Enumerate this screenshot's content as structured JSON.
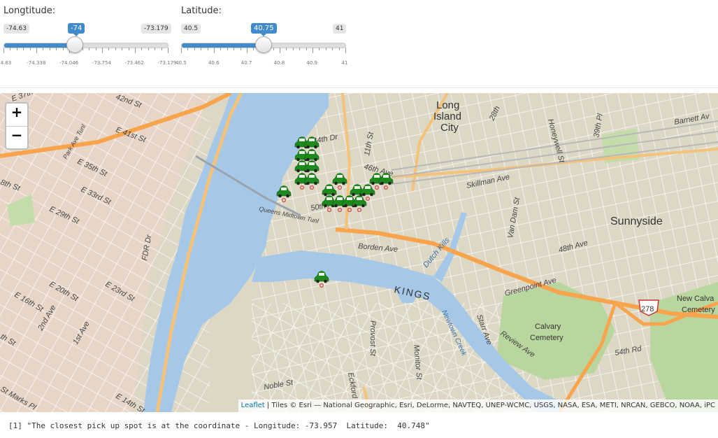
{
  "longitude_slider": {
    "title": "Longtitude:",
    "min_label": "-74.63",
    "max_label": "-73.179",
    "value_label": "-74",
    "value_fraction": 0.434,
    "tick_labels": [
      "-74.63",
      "-74.338",
      "-74.046",
      "-73.754",
      "-73.462",
      "-73.179"
    ]
  },
  "latitude_slider": {
    "title": "Latitude:",
    "min_label": "40.5",
    "max_label": "41",
    "value_label": "40.75",
    "value_fraction": 0.5,
    "tick_labels": [
      "40.5",
      "40.6",
      "40.7",
      "40.8",
      "40.9",
      "41"
    ]
  },
  "map": {
    "zoom_in_label": "+",
    "zoom_out_label": "−",
    "labels": {
      "long_island_city_1": "Long",
      "long_island_city_2": "Island",
      "long_island_city_3": "City",
      "sunnyside": "Sunnyside",
      "calvary_1": "Calvary",
      "calvary_2": "Cemetery",
      "new_calvary_1": "New Calva",
      "new_calvary_2": "Cemetery",
      "kings": "KINGS",
      "route": "278",
      "fdr": "FDR Dr",
      "e37": "E 37th St",
      "e42": "42nd St",
      "e41": "E 41st St",
      "e35": "E 35th St",
      "e33": "E 33rd St",
      "e29": "E 29th St",
      "e23": "E 23rd St",
      "e20": "E 20th St",
      "e16": "E 16th St",
      "e14": "E 14th St",
      "st_marks": "St Marks Pl",
      "first_ave": "1st Ave",
      "second_ave": "2nd Ave",
      "park_ave": "Park Ave Tunl",
      "e44dr": "44th Dr",
      "ave46": "46th Ave",
      "ave50": "50th Ave",
      "ave48": "48th Ave",
      "st11": "11th St",
      "st28": "28th",
      "skillman": "Skillman Ave",
      "borden": "Borden Ave",
      "greenpoint": "Greenpoint Ave",
      "review": "Review Ave",
      "st54": "54th Rd",
      "van_dam": "Van Dam St",
      "starr": "Starr Ave",
      "dutch_kills": "Dutch Kills",
      "newtown": "Newtown Creek",
      "provost": "Provost St",
      "monitor": "Monitor St",
      "eckford": "Eckford",
      "noble": "Noble St",
      "st39": "39th Pl",
      "honeywell": "Honeywell St",
      "barnett": "Barnett Av",
      "midtown": "Queens Midtown Tunl",
      "th8": "8th St",
      "th_st": "th St"
    },
    "attribution_link": "Leaflet",
    "attribution_text": " | Tiles © Esri — National Geographic, Esri, DeLorme, NAVTEQ, UNEP-WCMC, USGS, NASA, ESA, METI, NRCAN, GEBCO, NOAA, iPC",
    "marker_icon": "taxi-car-icon",
    "marker_count": 22
  },
  "output": {
    "text": "[1] \"The closest pick up spot is at the coordinate - Longitude: -73.957  Latitude:  40.748\""
  },
  "colors": {
    "slider_accent": "#428bca",
    "water": "#a6c8e8",
    "land": "#ddd8c6",
    "highway": "#f7a44c",
    "park": "#b8d69e",
    "marker_green": "#1e8a1e"
  }
}
